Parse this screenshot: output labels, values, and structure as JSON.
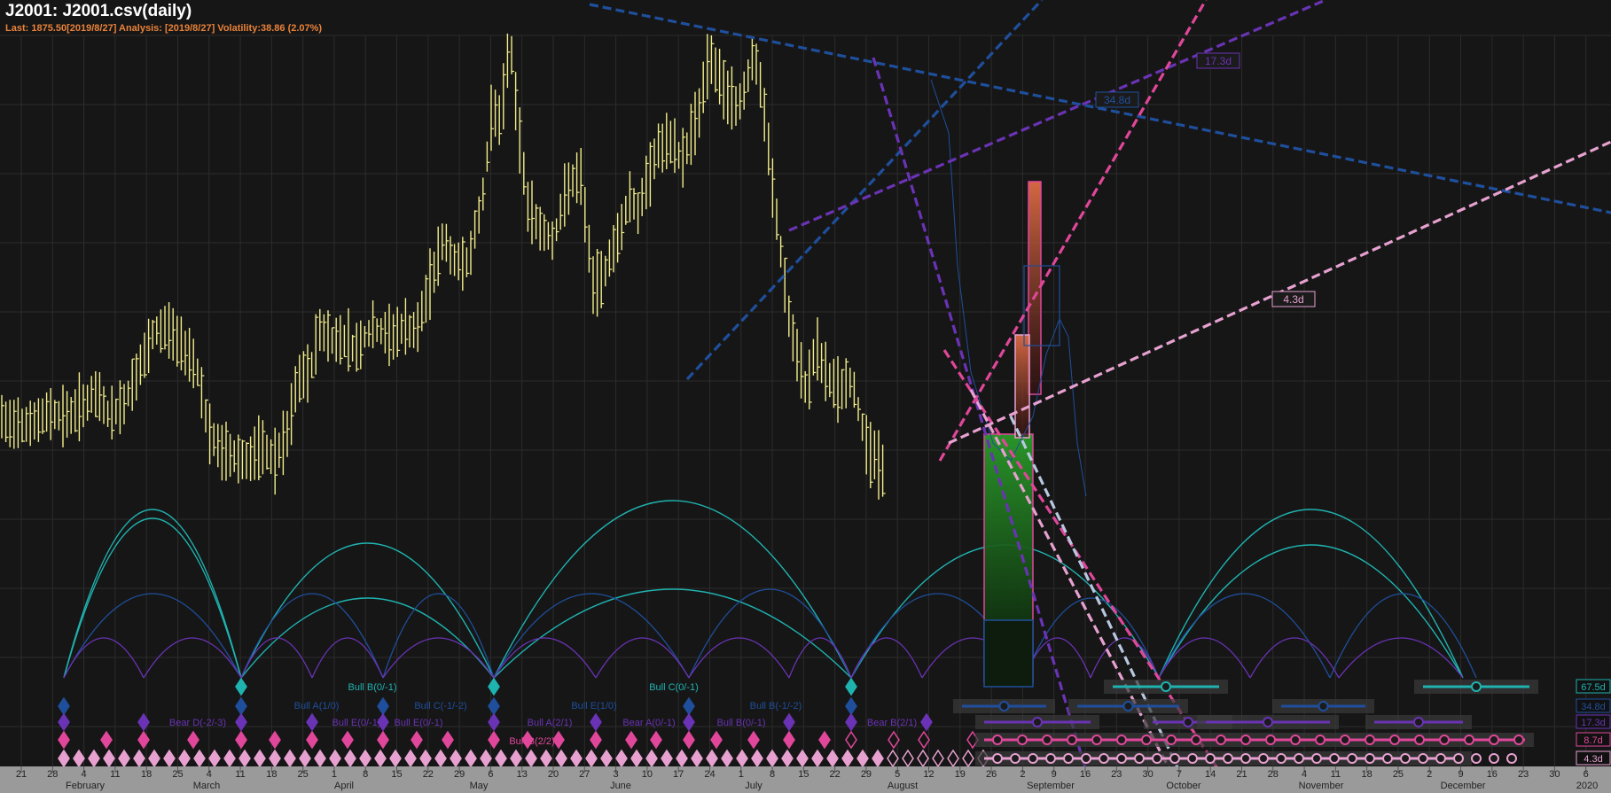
{
  "header": {
    "title": "J2001: J2001.csv(daily)",
    "status": "Last: 1875.50[2019/8/27] Analysis: [2019/8/27] Volatility:38.86 (2.07%)"
  },
  "colors": {
    "background": "#161616",
    "grid": "#2c2c2c",
    "price": "#f3ee8a",
    "navy": "#1f4f9c",
    "purple": "#6a33b5",
    "magenta": "#e0479a",
    "pink": "#e7a1d0",
    "teal": "#1fb3b0",
    "axisText": "#bdbdbd"
  },
  "chart_data": {
    "type": "bar",
    "title": "J2001: J2001.csv(daily)",
    "last_price": 1875.5,
    "last_date": "2019/8/27",
    "volatility": "38.86 (2.07%)",
    "x_axis": {
      "day_ticks": [
        "21",
        "28",
        "4",
        "11",
        "18",
        "25",
        "4",
        "11",
        "18",
        "25",
        "1",
        "8",
        "15",
        "22",
        "29",
        "6",
        "13",
        "20",
        "27",
        "3",
        "10",
        "17",
        "24",
        "1",
        "8",
        "15",
        "22",
        "29",
        "5",
        "12",
        "19",
        "26",
        "2",
        "9",
        "16",
        "23",
        "30",
        "7",
        "14",
        "21",
        "28",
        "4",
        "11",
        "18",
        "25",
        "2",
        "9",
        "16",
        "23",
        "30",
        "6"
      ],
      "months": [
        "February",
        "March",
        "April",
        "May",
        "June",
        "July",
        "August",
        "September",
        "October",
        "November",
        "December",
        "2020"
      ]
    },
    "price_path": [
      [
        0,
        470
      ],
      [
        8,
        480
      ],
      [
        20,
        475
      ],
      [
        40,
        478
      ],
      [
        55,
        465
      ],
      [
        75,
        470
      ],
      [
        110,
        445
      ],
      [
        125,
        470
      ],
      [
        140,
        455
      ],
      [
        160,
        410
      ],
      [
        175,
        375
      ],
      [
        190,
        370
      ],
      [
        200,
        385
      ],
      [
        215,
        400
      ],
      [
        225,
        425
      ],
      [
        235,
        490
      ],
      [
        250,
        510
      ],
      [
        265,
        515
      ],
      [
        280,
        520
      ],
      [
        295,
        505
      ],
      [
        310,
        520
      ],
      [
        325,
        490
      ],
      [
        335,
        430
      ],
      [
        350,
        420
      ],
      [
        360,
        370
      ],
      [
        375,
        385
      ],
      [
        390,
        380
      ],
      [
        400,
        395
      ],
      [
        420,
        370
      ],
      [
        440,
        380
      ],
      [
        455,
        370
      ],
      [
        470,
        375
      ],
      [
        485,
        320
      ],
      [
        500,
        270
      ],
      [
        515,
        300
      ],
      [
        530,
        290
      ],
      [
        545,
        220
      ],
      [
        555,
        120
      ],
      [
        565,
        140
      ],
      [
        575,
        40
      ],
      [
        585,
        150
      ],
      [
        595,
        230
      ],
      [
        610,
        260
      ],
      [
        625,
        270
      ],
      [
        640,
        210
      ],
      [
        655,
        200
      ],
      [
        670,
        330
      ],
      [
        680,
        310
      ],
      [
        700,
        260
      ],
      [
        710,
        220
      ],
      [
        720,
        240
      ],
      [
        740,
        170
      ],
      [
        755,
        160
      ],
      [
        770,
        180
      ],
      [
        790,
        120
      ],
      [
        800,
        60
      ],
      [
        815,
        100
      ],
      [
        830,
        120
      ],
      [
        840,
        100
      ],
      [
        850,
        60
      ],
      [
        860,
        110
      ],
      [
        870,
        200
      ],
      [
        880,
        280
      ],
      [
        890,
        360
      ],
      [
        900,
        410
      ],
      [
        910,
        440
      ],
      [
        920,
        390
      ],
      [
        930,
        420
      ],
      [
        945,
        440
      ],
      [
        960,
        430
      ],
      [
        970,
        470
      ],
      [
        980,
        510
      ],
      [
        990,
        520
      ],
      [
        1000,
        540
      ]
    ],
    "cycle_lanes": [
      {
        "period": "67.5d",
        "color": "#1fb3b0"
      },
      {
        "period": "34.8d",
        "color": "#1f4f9c"
      },
      {
        "period": "17.3d",
        "color": "#6a33b5"
      },
      {
        "period": "8.7d",
        "color": "#e0479a"
      },
      {
        "period": "4.3d",
        "color": "#e7a1d0"
      }
    ],
    "trend_line_labels": [
      "17.3d",
      "34.8d",
      "4.3d"
    ],
    "cycle_labels": [
      {
        "text": "Bull B(0/-1)",
        "color": "#1fb3b0"
      },
      {
        "text": "Bull C(0/-1)",
        "color": "#1fb3b0"
      },
      {
        "text": "Bull A(1/0)",
        "color": "#1f4f9c"
      },
      {
        "text": "Bull C(-1/-2)",
        "color": "#1f4f9c"
      },
      {
        "text": "Bull E(1/0)",
        "color": "#1f4f9c"
      },
      {
        "text": "Bull B(-1/-2)",
        "color": "#1f4f9c"
      },
      {
        "text": "Bear D(-2/-3)",
        "color": "#6a33b5"
      },
      {
        "text": "Bull E(0/-1)",
        "color": "#6a33b5"
      },
      {
        "text": "Bull E(0/-1)",
        "color": "#6a33b5"
      },
      {
        "text": "Bull A(2/1)",
        "color": "#6a33b5"
      },
      {
        "text": "Bear A(0/-1)",
        "color": "#6a33b5"
      },
      {
        "text": "Bull B(0/-1)",
        "color": "#6a33b5"
      },
      {
        "text": "Bear B(2/1)",
        "color": "#6a33b5"
      },
      {
        "text": "Bull B(2/2)",
        "color": "#e0479a"
      }
    ]
  }
}
